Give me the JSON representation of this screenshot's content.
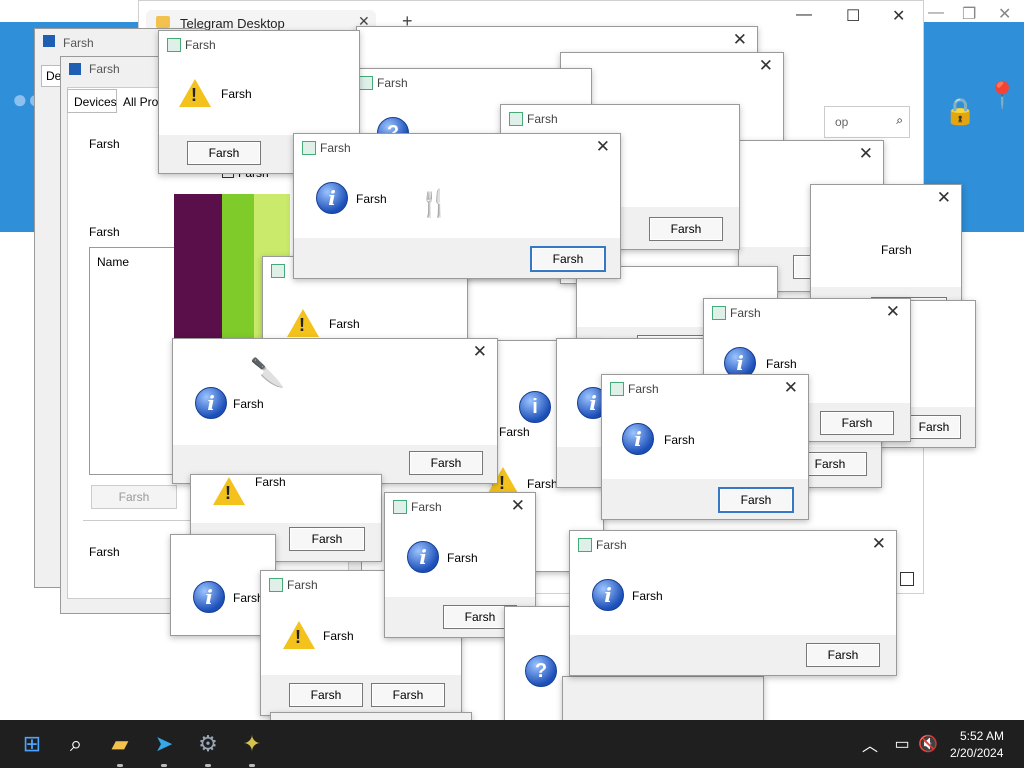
{
  "telegram": {
    "tab_title": "Telegram Desktop",
    "search_placeholder": "op"
  },
  "dialog": {
    "title": "Farsh",
    "message": "Farsh",
    "button": "Farsh"
  },
  "settings": {
    "title": "Farsh",
    "tabs": [
      "Devices",
      "All Profiles"
    ],
    "tab_de": "De",
    "row1": "Farsh",
    "row2": "Farsh",
    "list_header": "Name",
    "checkbox": "Farsh",
    "disabled_button": "Farsh",
    "footer": "Farsh"
  },
  "taskbar": {
    "time": "5:52 AM",
    "date": "2/20/2024",
    "icons": [
      "windows-start-icon",
      "search-icon",
      "file-explorer-icon",
      "telegram-icon",
      "settings-gear-icon",
      "app-icon"
    ]
  },
  "colors": {
    "accent": "#3478c6",
    "telegram_blue": "#2f8fd8",
    "taskbar": "#1f1f1f",
    "warning": "#f3c21c"
  }
}
